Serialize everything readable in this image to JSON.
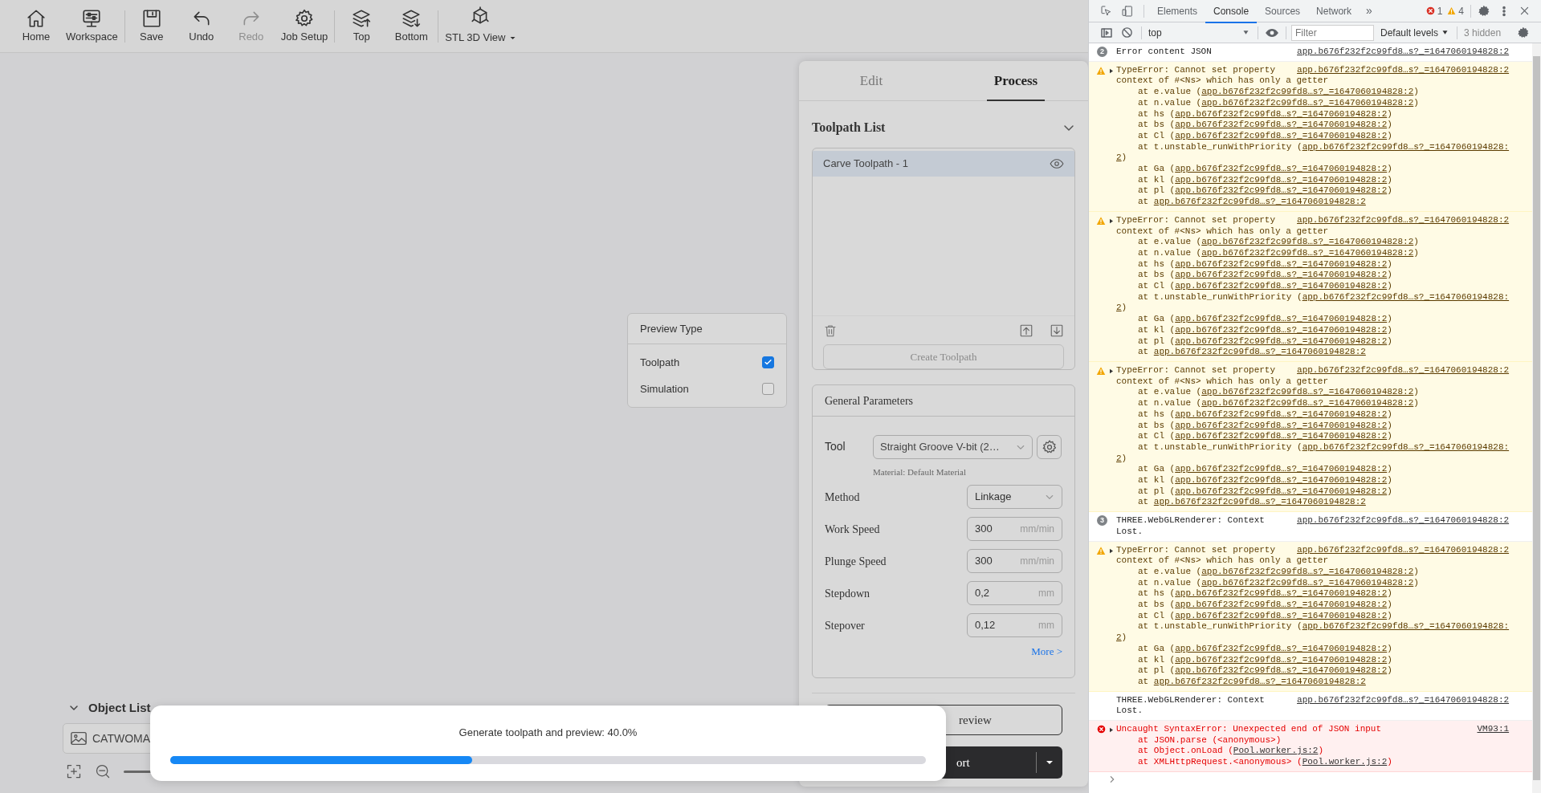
{
  "toolbar_groups": [
    [
      {
        "label": "Home",
        "kind": "home",
        "disabled": false,
        "dropdown": false
      },
      {
        "label": "Workspace",
        "kind": "workspace",
        "disabled": false,
        "dropdown": false
      }
    ],
    [
      {
        "label": "Save",
        "kind": "save",
        "disabled": false,
        "dropdown": false
      },
      {
        "label": "Undo",
        "kind": "undo",
        "disabled": false,
        "dropdown": false
      },
      {
        "label": "Redo",
        "kind": "redo",
        "disabled": true,
        "dropdown": false
      },
      {
        "label": "Job Setup",
        "kind": "settings",
        "disabled": false,
        "dropdown": false
      }
    ],
    [
      {
        "label": "Top",
        "kind": "top",
        "disabled": false,
        "dropdown": false
      },
      {
        "label": "Bottom",
        "kind": "bottom",
        "disabled": false,
        "dropdown": false
      }
    ],
    [
      {
        "label": "STL 3D View",
        "kind": "cube",
        "disabled": false,
        "dropdown": true
      }
    ]
  ],
  "preview_type": {
    "title": "Preview Type",
    "options": [
      {
        "label": "Toolpath",
        "checked": true
      },
      {
        "label": "Simulation",
        "checked": false
      }
    ]
  },
  "object_list": {
    "title": "Object List",
    "expanded": true,
    "items": [
      {
        "label": "CATWOMA"
      }
    ]
  },
  "panel": {
    "tabs": [
      {
        "label": "Edit",
        "selected": false
      },
      {
        "label": "Process",
        "selected": true
      }
    ],
    "toolpath_list": {
      "title": "Toolpath List",
      "expanded": true,
      "items": [
        {
          "label": "Carve Toolpath - 1",
          "selected": true
        }
      ],
      "create_button": {
        "label": "Create Toolpath",
        "disabled": true
      }
    },
    "general_parameters": {
      "title": "General Parameters",
      "tool": {
        "label": "Tool",
        "value": "Straight Groove V-bit (2…",
        "material": "Material: Default Material"
      },
      "fields": [
        {
          "label": "Method",
          "kind": "select",
          "value": "Linkage"
        },
        {
          "label": "Work Speed",
          "kind": "number",
          "value": "300",
          "unit": "mm/min"
        },
        {
          "label": "Plunge Speed",
          "kind": "number",
          "value": "300",
          "unit": "mm/min"
        },
        {
          "label": "Stepdown",
          "kind": "number",
          "value": "0,2",
          "unit": "mm"
        },
        {
          "label": "Stepover",
          "kind": "number",
          "value": "0,12",
          "unit": "mm"
        }
      ],
      "more_link": "More >"
    },
    "preview_button": "review",
    "export_button": "ort"
  },
  "progress": {
    "text": "Generate toolpath and preview: 40.0%",
    "level": 0.4
  },
  "devtools": {
    "tabs": [
      {
        "label": "Elements",
        "selected": false
      },
      {
        "label": "Console",
        "selected": true
      },
      {
        "label": "Sources",
        "selected": false
      },
      {
        "label": "Network",
        "selected": false
      }
    ],
    "more_tabs": "»",
    "error_count": "1",
    "warning_count": "4",
    "context": "top",
    "filter_placeholder": "Filter",
    "levels": "Default levels",
    "hidden": "3 hidden",
    "messages": [
      {
        "kind": "info",
        "count": "2",
        "text": "Error content JSON",
        "source": "app.b676f232f2c99fd8…s?_=1647060194828:2"
      },
      {
        "kind": "warning",
        "text_lines": [
          "TypeError: Cannot set property",
          "context of #<Ns> which has only a getter"
        ],
        "source": "app.b676f232f2c99fd8…s?_=1647060194828:2",
        "stack": [
          {
            "prefix": "at e.value (",
            "link": "app.b676f232f2c99fd8…s?_=1647060194828:2",
            "suffix": ")"
          },
          {
            "prefix": "at n.value (",
            "link": "app.b676f232f2c99fd8…s?_=1647060194828:2",
            "suffix": ")"
          },
          {
            "prefix": "at hs (",
            "link": "app.b676f232f2c99fd8…s?_=1647060194828:2",
            "suffix": ")"
          },
          {
            "prefix": "at bs (",
            "link": "app.b676f232f2c99fd8…s?_=1647060194828:2",
            "suffix": ")"
          },
          {
            "prefix": "at Cl (",
            "link": "app.b676f232f2c99fd8…s?_=1647060194828:2",
            "suffix": ")"
          },
          {
            "prefix": "at t.unstable_runWithPriority (",
            "link": "app.b676f232f2c99fd8…s?_=1647060194828:",
            "link_cont": "2",
            "suffix": ")"
          },
          {
            "prefix": "at Ga (",
            "link": "app.b676f232f2c99fd8…s?_=1647060194828:2",
            "suffix": ")"
          },
          {
            "prefix": "at kl (",
            "link": "app.b676f232f2c99fd8…s?_=1647060194828:2",
            "suffix": ")"
          },
          {
            "prefix": "at pl (",
            "link": "app.b676f232f2c99fd8…s?_=1647060194828:2",
            "suffix": ")"
          },
          {
            "prefix": "at ",
            "link": "app.b676f232f2c99fd8…s?_=1647060194828:2"
          }
        ]
      },
      {
        "kind": "warning",
        "text_lines": [
          "TypeError: Cannot set property",
          "context of #<Ns> which has only a getter"
        ],
        "source": "app.b676f232f2c99fd8…s?_=1647060194828:2",
        "stack": [
          {
            "prefix": "at e.value (",
            "link": "app.b676f232f2c99fd8…s?_=1647060194828:2",
            "suffix": ")"
          },
          {
            "prefix": "at n.value (",
            "link": "app.b676f232f2c99fd8…s?_=1647060194828:2",
            "suffix": ")"
          },
          {
            "prefix": "at hs (",
            "link": "app.b676f232f2c99fd8…s?_=1647060194828:2",
            "suffix": ")"
          },
          {
            "prefix": "at bs (",
            "link": "app.b676f232f2c99fd8…s?_=1647060194828:2",
            "suffix": ")"
          },
          {
            "prefix": "at Cl (",
            "link": "app.b676f232f2c99fd8…s?_=1647060194828:2",
            "suffix": ")"
          },
          {
            "prefix": "at t.unstable_runWithPriority (",
            "link": "app.b676f232f2c99fd8…s?_=1647060194828:",
            "link_cont": "2",
            "suffix": ")"
          },
          {
            "prefix": "at Ga (",
            "link": "app.b676f232f2c99fd8…s?_=1647060194828:2",
            "suffix": ")"
          },
          {
            "prefix": "at kl (",
            "link": "app.b676f232f2c99fd8…s?_=1647060194828:2",
            "suffix": ")"
          },
          {
            "prefix": "at pl (",
            "link": "app.b676f232f2c99fd8…s?_=1647060194828:2",
            "suffix": ")"
          },
          {
            "prefix": "at ",
            "link": "app.b676f232f2c99fd8…s?_=1647060194828:2"
          }
        ]
      },
      {
        "kind": "warning",
        "text_lines": [
          "TypeError: Cannot set property",
          "context of #<Ns> which has only a getter"
        ],
        "source": "app.b676f232f2c99fd8…s?_=1647060194828:2",
        "stack": [
          {
            "prefix": "at e.value (",
            "link": "app.b676f232f2c99fd8…s?_=1647060194828:2",
            "suffix": ")"
          },
          {
            "prefix": "at n.value (",
            "link": "app.b676f232f2c99fd8…s?_=1647060194828:2",
            "suffix": ")"
          },
          {
            "prefix": "at hs (",
            "link": "app.b676f232f2c99fd8…s?_=1647060194828:2",
            "suffix": ")"
          },
          {
            "prefix": "at bs (",
            "link": "app.b676f232f2c99fd8…s?_=1647060194828:2",
            "suffix": ")"
          },
          {
            "prefix": "at Cl (",
            "link": "app.b676f232f2c99fd8…s?_=1647060194828:2",
            "suffix": ")"
          },
          {
            "prefix": "at t.unstable_runWithPriority (",
            "link": "app.b676f232f2c99fd8…s?_=1647060194828:",
            "link_cont": "2",
            "suffix": ")"
          },
          {
            "prefix": "at Ga (",
            "link": "app.b676f232f2c99fd8…s?_=1647060194828:2",
            "suffix": ")"
          },
          {
            "prefix": "at kl (",
            "link": "app.b676f232f2c99fd8…s?_=1647060194828:2",
            "suffix": ")"
          },
          {
            "prefix": "at pl (",
            "link": "app.b676f232f2c99fd8…s?_=1647060194828:2",
            "suffix": ")"
          },
          {
            "prefix": "at ",
            "link": "app.b676f232f2c99fd8…s?_=1647060194828:2"
          }
        ]
      },
      {
        "kind": "info",
        "count": "3",
        "text": "THREE.WebGLRenderer: Context Lost.",
        "source": "app.b676f232f2c99fd8…s?_=1647060194828:2"
      },
      {
        "kind": "warning",
        "text_lines": [
          "TypeError: Cannot set property",
          "context of #<Ns> which has only a getter"
        ],
        "source": "app.b676f232f2c99fd8…s?_=1647060194828:2",
        "stack": [
          {
            "prefix": "at e.value (",
            "link": "app.b676f232f2c99fd8…s?_=1647060194828:2",
            "suffix": ")"
          },
          {
            "prefix": "at n.value (",
            "link": "app.b676f232f2c99fd8…s?_=1647060194828:2",
            "suffix": ")"
          },
          {
            "prefix": "at hs (",
            "link": "app.b676f232f2c99fd8…s?_=1647060194828:2",
            "suffix": ")"
          },
          {
            "prefix": "at bs (",
            "link": "app.b676f232f2c99fd8…s?_=1647060194828:2",
            "suffix": ")"
          },
          {
            "prefix": "at Cl (",
            "link": "app.b676f232f2c99fd8…s?_=1647060194828:2",
            "suffix": ")"
          },
          {
            "prefix": "at t.unstable_runWithPriority (",
            "link": "app.b676f232f2c99fd8…s?_=1647060194828:",
            "link_cont": "2",
            "suffix": ")"
          },
          {
            "prefix": "at Ga (",
            "link": "app.b676f232f2c99fd8…s?_=1647060194828:2",
            "suffix": ")"
          },
          {
            "prefix": "at kl (",
            "link": "app.b676f232f2c99fd8…s?_=1647060194828:2",
            "suffix": ")"
          },
          {
            "prefix": "at pl (",
            "link": "app.b676f232f2c99fd8…s?_=1647060194828:2",
            "suffix": ")"
          },
          {
            "prefix": "at ",
            "link": "app.b676f232f2c99fd8…s?_=1647060194828:2"
          }
        ]
      },
      {
        "kind": "log",
        "text": "THREE.WebGLRenderer: Context Lost.",
        "source": "app.b676f232f2c99fd8…s?_=1647060194828:2"
      },
      {
        "kind": "error",
        "text": "Uncaught SyntaxError: Unexpected end of JSON input",
        "source": "VM93:1",
        "stack": [
          {
            "prefix": "at JSON.parse (<anonymous>)"
          },
          {
            "prefix": "at Object.onLoad (",
            "link": "Pool.worker.js:2",
            "suffix": ")"
          },
          {
            "prefix": "at XMLHttpRequest.<anonymous> (",
            "link": "Pool.worker.js:2",
            "suffix": ")"
          }
        ]
      }
    ]
  }
}
